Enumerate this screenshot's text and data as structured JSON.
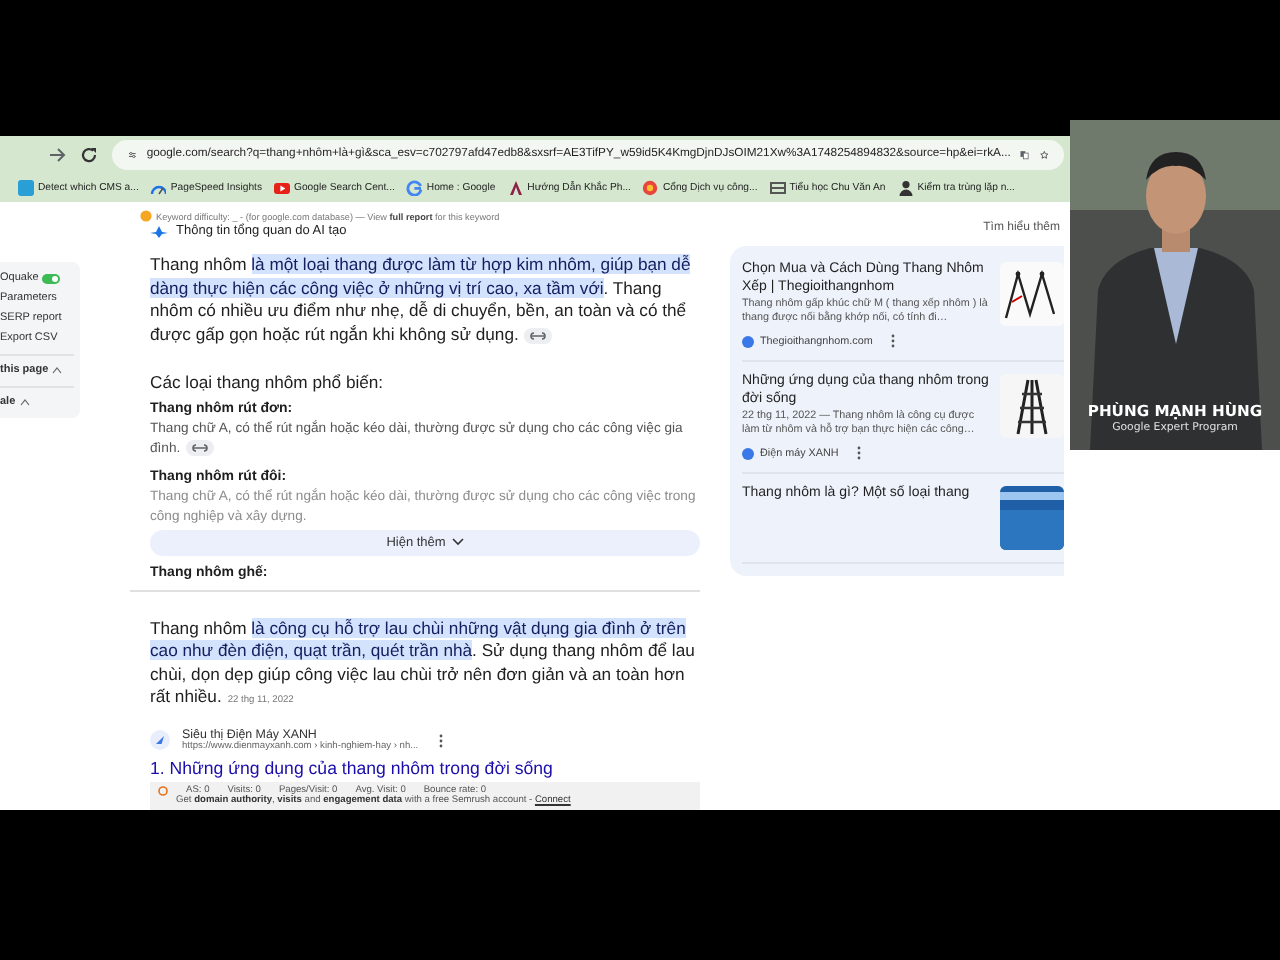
{
  "address_bar": {
    "url": "google.com/search?q=thang+nhôm+là+gì&sca_esv=c702797afd47edb8&sxsrf=AE3TifPY_w59id5K4KmgDjnDJsOIM21Xw%3A1748254894832&source=hp&ei=rkA..."
  },
  "bookmarks": [
    {
      "label": "Detect which CMS a..."
    },
    {
      "label": "PageSpeed Insights"
    },
    {
      "label": "Google Search Cent..."
    },
    {
      "label": "Home : Google"
    },
    {
      "label": "Hướng Dẫn Khắc Ph..."
    },
    {
      "label": "Cổng Dịch vụ công..."
    },
    {
      "label": "Tiểu học Chu Văn An"
    },
    {
      "label": "Kiểm tra trùng lặp n..."
    }
  ],
  "sidebar": {
    "items": [
      {
        "kind": "toggle",
        "label": "Oquake",
        "on": true
      },
      {
        "kind": "link",
        "label": "Parameters"
      },
      {
        "kind": "link",
        "label": "SERP report"
      },
      {
        "kind": "link",
        "label": "Export CSV"
      },
      {
        "kind": "section",
        "label": "this page",
        "expanded": true
      },
      {
        "kind": "section",
        "label": "ale",
        "expanded": true
      }
    ]
  },
  "keyword_bar": {
    "text": "Keyword difficulty: _ - (for google.com database) — View **full report** for this keyword"
  },
  "ai_overview": {
    "title": "Thông tin tổng quan do AI tạo",
    "learn_more": "Tìm hiểu thêm",
    "blocks": [
      {
        "kind": "paragraph",
        "link_chip": true,
        "parts": [
          {
            "text": "Thang nhôm ",
            "highlighted": false
          },
          {
            "text": "là một loại thang được làm từ hợp kim nhôm, giúp bạn dễ dàng thực hiện các công việc ở những vị trí cao, xa tầm với",
            "highlighted": true
          },
          {
            "text": ". Thang nhôm có nhiều ưu điểm như nhẹ, dễ di chuyển, bền, an toàn và có thể được gấp gọn hoặc rút ngắn khi không sử dụng.",
            "highlighted": false
          }
        ]
      },
      {
        "kind": "heading",
        "text": "Các loại thang nhôm phổ biến:"
      },
      {
        "kind": "subheading",
        "text": "Thang nhôm rút đơn:"
      },
      {
        "kind": "detail",
        "link_chip": true,
        "faded": false,
        "text": "Thang chữ A, có thể rút ngắn hoặc kéo dài, thường được sử dụng cho các công việc gia đình."
      },
      {
        "kind": "subheading",
        "text": "Thang nhôm rút đôi:"
      },
      {
        "kind": "detail",
        "link_chip": false,
        "faded": true,
        "text": "Thang chữ A, có thể rút ngắn hoặc kéo dài, thường được sử dụng cho các công việc trong công nghiệp và xây dựng."
      },
      {
        "kind": "subheading",
        "text": "Thang nhôm ghế:"
      }
    ],
    "show_more": "Hiện thêm",
    "sources": [
      {
        "title": "Chọn Mua và Cách Dùng Thang Nhôm Xếp | Thegioithangnhom",
        "snippet": "Thang nhôm gấp khúc chữ M ( thang xếp nhôm ) là thang được nối bằng khớp nối, có tính đi…",
        "site": "Thegioithangnhom.com"
      },
      {
        "title": "Những ứng dụng của thang nhôm trong đời sống",
        "snippet": "22 thg 11, 2022 — Thang nhôm là công cụ được làm từ nhôm và hỗ trợ bạn thực hiện các công…",
        "site": "Điện máy XANH"
      },
      {
        "title": "Thang nhôm là gì? Một số loại thang"
      }
    ]
  },
  "featured_snippet": {
    "parts": [
      {
        "text": "Thang nhôm ",
        "highlighted": false
      },
      {
        "text": "là công cụ hỗ trợ lau chùi những vật dụng gia đình ở trên cao như đèn điện, quạt trần, quét trần nhà",
        "highlighted": true
      },
      {
        "text": ". Sử dụng thang nhôm để lau chùi, dọn dẹp giúp công việc lau chùi trở nên đơn giản và an toàn hơn rất nhiều.",
        "highlighted": false
      }
    ],
    "date": "22 thg 11, 2022",
    "site_name": "Siêu thị Điện Máy XANH",
    "site_url": "https://www.dienmayxanh.com › kinh-nghiem-hay › nh...",
    "title": "1. Những ứng dụng của thang nhôm trong đời sống",
    "seo_bar": {
      "metrics": [
        "AS: 0",
        "Visits: 0",
        "Pages/Visit: 0",
        "Avg. Visit: 0",
        "Bounce rate: 0"
      ],
      "note": "Get **domain authority**, **visits** and **engagement data** with a free Semrush account -",
      "connect": "Connect"
    }
  },
  "presenter": {
    "name": "PHÙNG MẠNH HÙNG",
    "role": "Google Expert Program"
  }
}
